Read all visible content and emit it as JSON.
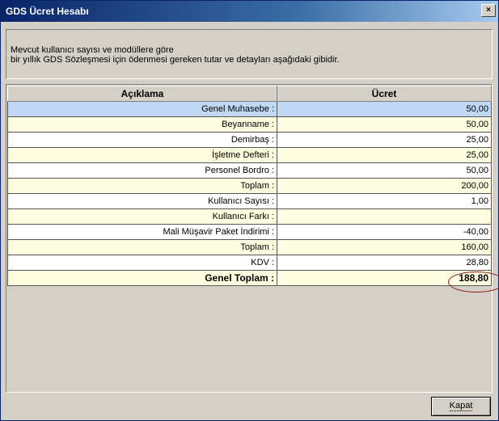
{
  "window": {
    "title": "GDS Ücret Hesabı",
    "close_glyph": "×"
  },
  "info": {
    "line1": "Mevcut kullanıcı sayısı ve modüllere göre",
    "line2": "bir yıllık GDS Sözleşmesi için ödenmesi gereken tutar ve detayları aşağıdaki gibidir."
  },
  "table": {
    "headers": [
      "Açıklama",
      "Ücret"
    ],
    "rows": [
      {
        "label": "Genel Muhasebe :",
        "value": "50,00",
        "style": "blue"
      },
      {
        "label": "Beyanname :",
        "value": "50,00",
        "style": "yellow"
      },
      {
        "label": "Demirbaş :",
        "value": "25,00",
        "style": "white"
      },
      {
        "label": "İşletme Defteri :",
        "value": "25,00",
        "style": "yellow"
      },
      {
        "label": "Personel Bordro :",
        "value": "50,00",
        "style": "white"
      },
      {
        "label": "Toplam :",
        "value": "200,00",
        "style": "yellow"
      },
      {
        "label": "Kullanıcı Sayısı :",
        "value": "1,00",
        "style": "white"
      },
      {
        "label": "Kullanıcı Farkı :",
        "value": "",
        "style": "yellow"
      },
      {
        "label": "Mali Müşavir Paket İndirimi :",
        "value": "-40,00",
        "style": "white"
      },
      {
        "label": "Toplam :",
        "value": "160,00",
        "style": "yellow"
      },
      {
        "label": "KDV :",
        "value": "28,80",
        "style": "white"
      },
      {
        "label": "Genel Toplam :",
        "value": "188,80",
        "style": "yellow bold"
      }
    ]
  },
  "buttons": {
    "close_label": "Kapat"
  },
  "colors": {
    "title_start": "#0a246a",
    "row_yellow": "#fffde0",
    "row_blue": "#c0d8f4",
    "highlight_ellipse": "#8b1a1a"
  }
}
